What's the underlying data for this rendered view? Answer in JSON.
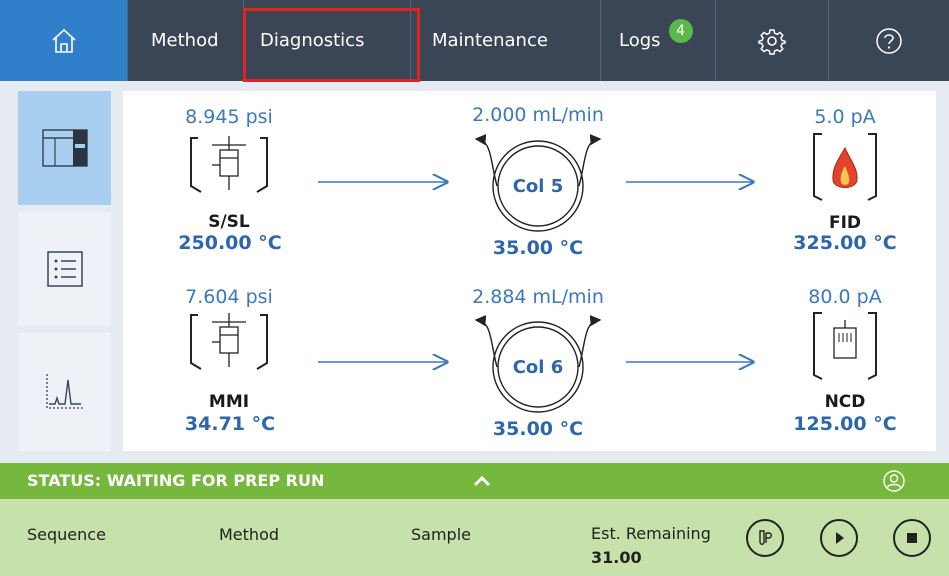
{
  "nav": {
    "method": "Method",
    "diagnostics": "Diagnostics",
    "maintenance": "Maintenance",
    "logs": "Logs",
    "logs_badge": "4",
    "home_icon": "home-icon",
    "settings_icon": "gear-icon",
    "help_icon": "help-icon"
  },
  "rail": [
    {
      "icon": "instrument-icon",
      "active": true
    },
    {
      "icon": "list-icon",
      "active": false
    },
    {
      "icon": "chromatogram-icon",
      "active": false
    }
  ],
  "flowpath": {
    "row1": {
      "inlet": {
        "pressure": "8.945 psi",
        "name": "S/SL",
        "temp": "250.00 °C"
      },
      "column": {
        "flow": "2.000 mL/min",
        "name": "Col 5",
        "temp": "35.00 °C"
      },
      "detector": {
        "signal": "5.0 pA",
        "name": "FID",
        "temp": "325.00 °C"
      }
    },
    "row2": {
      "inlet": {
        "pressure": "7.604 psi",
        "name": "MMI",
        "temp": "34.71 °C"
      },
      "column": {
        "flow": "2.884 mL/min",
        "name": "Col 6",
        "temp": "35.00 °C"
      },
      "detector": {
        "signal": "80.0 pA",
        "name": "NCD",
        "temp": "125.00 °C"
      }
    }
  },
  "status": {
    "text": "STATUS: WAITING FOR PREP RUN",
    "expand_icon": "chevron-up-icon",
    "user_icon": "user-icon"
  },
  "bottom": {
    "sequence": "Sequence",
    "method": "Method",
    "sample": "Sample",
    "est_remaining_label": "Est. Remaining",
    "est_remaining_value": "31.00"
  },
  "colors": {
    "nav_bg": "#3a4656",
    "home_bg": "#2f7fcb",
    "accent_blue": "#3c78be",
    "status_green": "#76b83d",
    "bottom_green": "#c7e1aa",
    "highlight_red": "#e02424"
  }
}
